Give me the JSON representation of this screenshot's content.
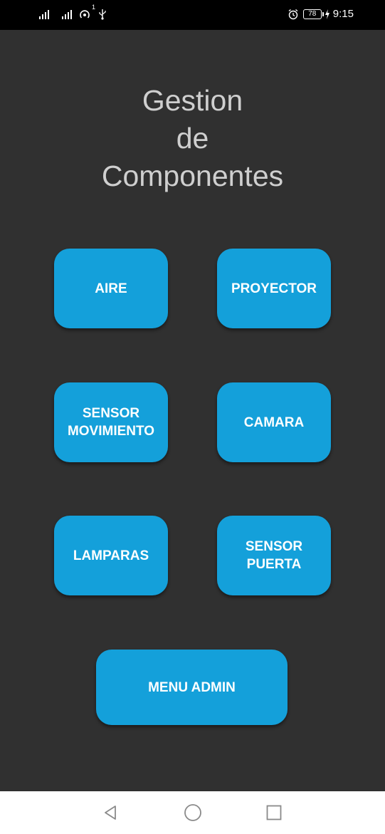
{
  "status_bar": {
    "time": "9:15",
    "battery_level": "78",
    "data_roaming_badge": "1",
    "icons": [
      "signal-icon",
      "signal-icon-2",
      "hotspot-icon",
      "usb-icon",
      "alarm-icon",
      "battery-icon",
      "charging-icon"
    ]
  },
  "header": {
    "title_line1": "Gestion",
    "title_line2": "de",
    "title_line3": "Componentes"
  },
  "buttons": {
    "aire": "AIRE",
    "proyector": "PROYECTOR",
    "sensor_movimiento": "SENSOR\nMOVIMIENTO",
    "camara": "CAMARA",
    "lamparas": "LAMPARAS",
    "sensor_puerta": "SENSOR\nPUERTA",
    "menu_admin": "MENU ADMIN"
  },
  "nav_bar": {
    "icons": [
      "back-icon",
      "home-icon",
      "recents-icon"
    ]
  },
  "colors": {
    "background": "#303030",
    "button": "#14a0da",
    "title_text": "#cfcfcf",
    "status_bar": "#000000",
    "nav_bar": "#ffffff"
  }
}
